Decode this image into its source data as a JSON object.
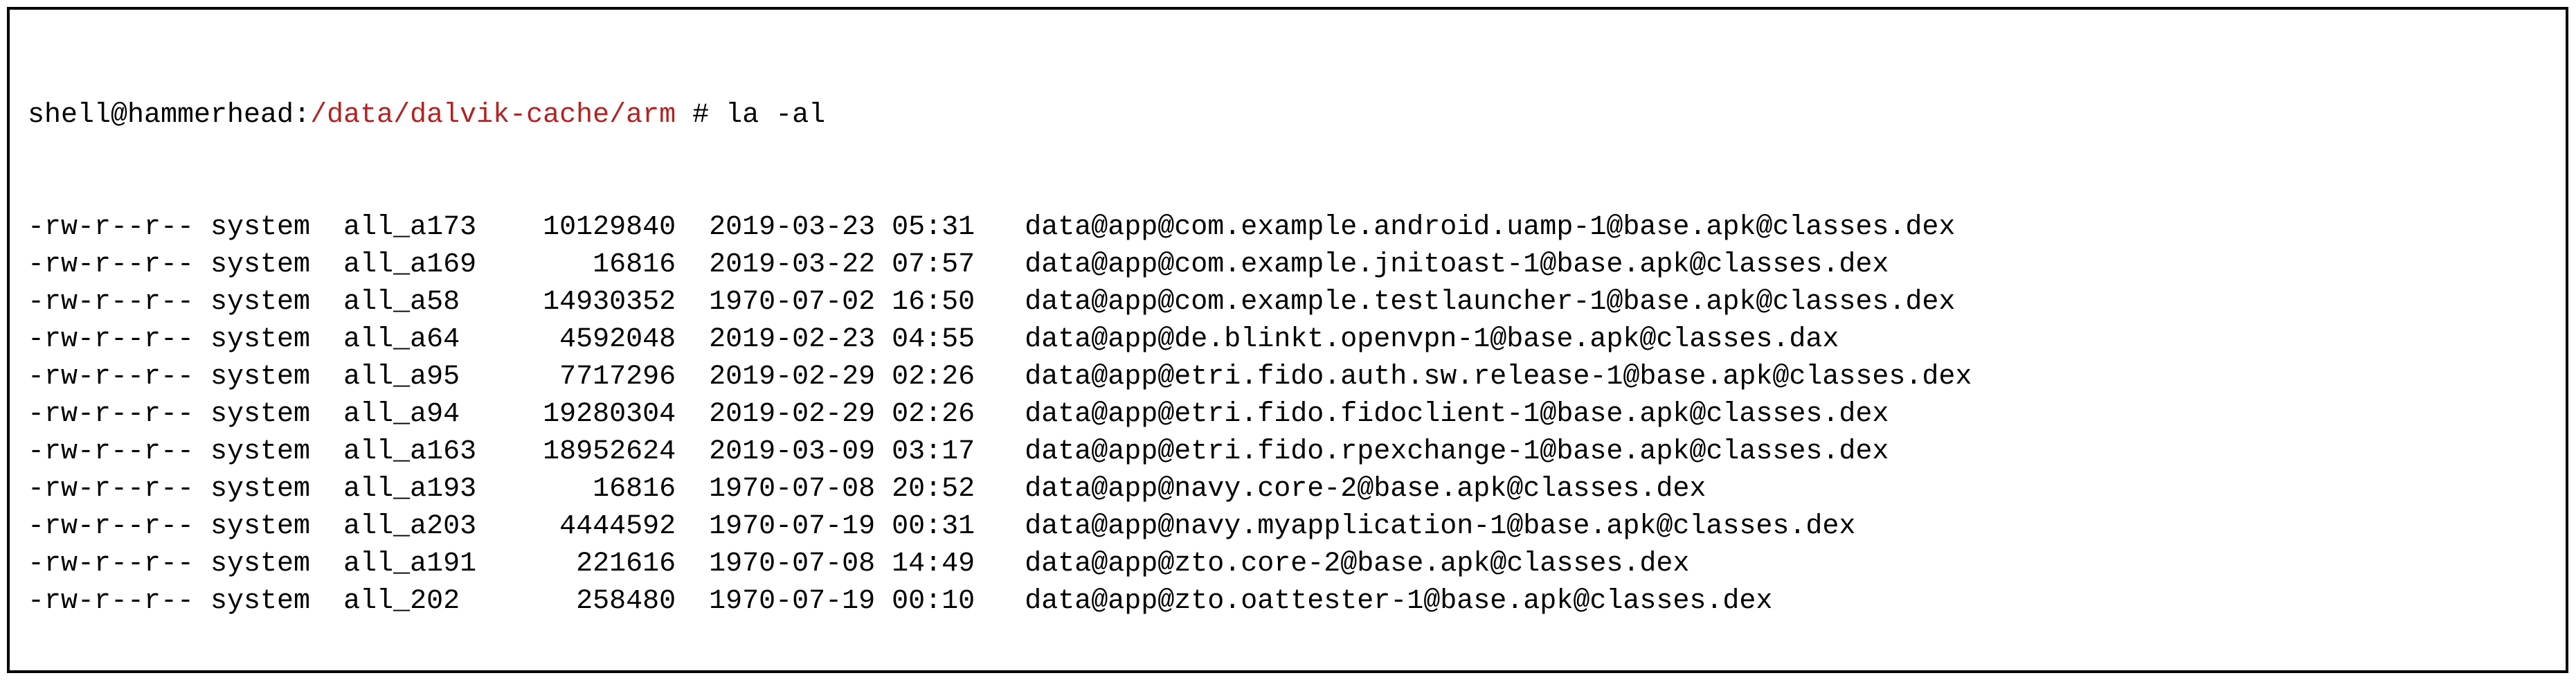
{
  "prompt": {
    "host": "shell@hammerhead:",
    "path": "/data/dalvik-cache/arm",
    "sep": " # ",
    "cmd": "la -al"
  },
  "listing": [
    {
      "perm": "-rw-r--r--",
      "owner": "system",
      "group": "all_a173",
      "size": "10129840",
      "date": "2019-03-23",
      "time": "05:31",
      "name": "data@app@com.example.android.uamp-1@base.apk@classes.dex"
    },
    {
      "perm": "-rw-r--r--",
      "owner": "system",
      "group": "all_a169",
      "size": "16816",
      "date": "2019-03-22",
      "time": "07:57",
      "name": "data@app@com.example.jnitoast-1@base.apk@classes.dex"
    },
    {
      "perm": "-rw-r--r--",
      "owner": "system",
      "group": "all_a58",
      "size": "14930352",
      "date": "1970-07-02",
      "time": "16:50",
      "name": "data@app@com.example.testlauncher-1@base.apk@classes.dex"
    },
    {
      "perm": "-rw-r--r--",
      "owner": "system",
      "group": "all_a64",
      "size": "4592048",
      "date": "2019-02-23",
      "time": "04:55",
      "name": "data@app@de.blinkt.openvpn-1@base.apk@classes.dax"
    },
    {
      "perm": "-rw-r--r--",
      "owner": "system",
      "group": "all_a95",
      "size": "7717296",
      "date": "2019-02-29",
      "time": "02:26",
      "name": "data@app@etri.fido.auth.sw.release-1@base.apk@classes.dex"
    },
    {
      "perm": "-rw-r--r--",
      "owner": "system",
      "group": "all_a94",
      "size": "19280304",
      "date": "2019-02-29",
      "time": "02:26",
      "name": "data@app@etri.fido.fidoclient-1@base.apk@classes.dex"
    },
    {
      "perm": "-rw-r--r--",
      "owner": "system",
      "group": "all_a163",
      "size": "18952624",
      "date": "2019-03-09",
      "time": "03:17",
      "name": "data@app@etri.fido.rpexchange-1@base.apk@classes.dex"
    },
    {
      "perm": "-rw-r--r--",
      "owner": "system",
      "group": "all_a193",
      "size": "16816",
      "date": "1970-07-08",
      "time": "20:52",
      "name": "data@app@navy.core-2@base.apk@classes.dex"
    },
    {
      "perm": "-rw-r--r--",
      "owner": "system",
      "group": "all_a203",
      "size": "4444592",
      "date": "1970-07-19",
      "time": "00:31",
      "name": "data@app@navy.myapplication-1@base.apk@classes.dex"
    },
    {
      "perm": "-rw-r--r--",
      "owner": "system",
      "group": "all_a191",
      "size": "221616",
      "date": "1970-07-08",
      "time": "14:49",
      "name": "data@app@zto.core-2@base.apk@classes.dex"
    },
    {
      "perm": "-rw-r--r--",
      "owner": "system",
      "group": "all_202",
      "size": "258480",
      "date": "1970-07-19",
      "time": "00:10",
      "name": "data@app@zto.oattester-1@base.apk@classes.dex"
    }
  ]
}
